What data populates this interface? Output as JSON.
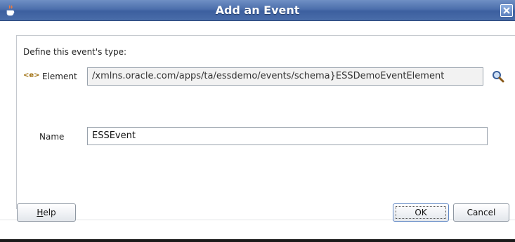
{
  "window": {
    "title": "Add an Event",
    "title_icon": "java-cup-icon",
    "close_icon": "close-icon"
  },
  "form": {
    "section_label": "Define this event's type:",
    "element": {
      "icon": "xml-element-icon",
      "icon_glyph": "<e>",
      "label": "Element",
      "value": "/xmlns.oracle.com/apps/ta/essdemo/events/schema}ESSDemoEventElement",
      "search_icon": "magnifier-icon"
    },
    "name": {
      "label": "Name",
      "value": "ESSEvent"
    }
  },
  "buttons": {
    "help_mnemonic": "H",
    "help_rest": "elp",
    "ok": "OK",
    "cancel": "Cancel"
  },
  "colors": {
    "titlebar": "#4c6fac",
    "title_text": "#ffffff"
  }
}
